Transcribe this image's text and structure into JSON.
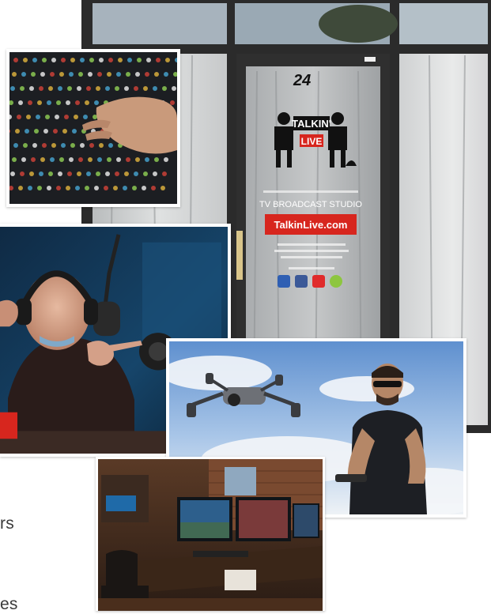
{
  "storefront": {
    "door_number": "24",
    "logo_line1": "TALKIN'",
    "logo_line2": "LIVE",
    "studio_label": "TV BROADCAST STUDIO",
    "website_badge": "TalkinLive.com"
  },
  "clipped_text": {
    "line1": "rs",
    "line2": "es"
  },
  "colors": {
    "brand_red": "#d7261e",
    "sky_blue": "#6e9cd4"
  }
}
